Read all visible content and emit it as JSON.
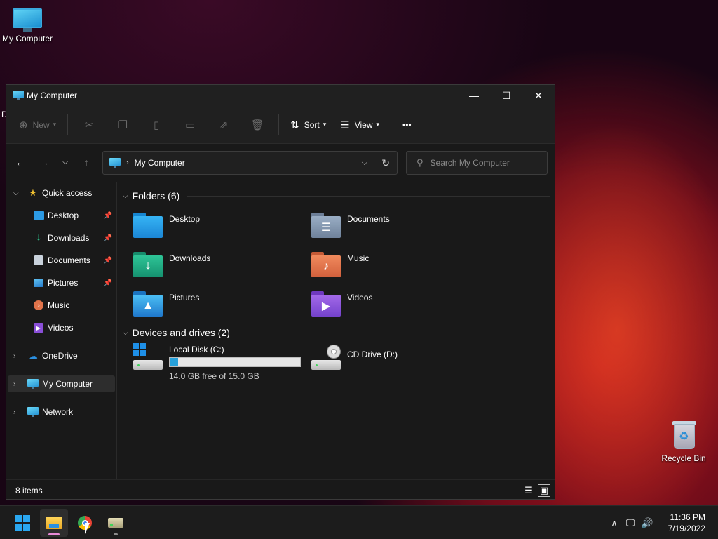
{
  "desktop": {
    "icons": [
      {
        "label": "My Computer"
      },
      {
        "label": "Recycle Bin"
      }
    ],
    "clipped_label": "D"
  },
  "window": {
    "title": "My Computer",
    "controls": {
      "minimize": "—",
      "maximize": "☐",
      "close": "✕"
    }
  },
  "toolbar": {
    "new_label": "New",
    "sort_label": "Sort",
    "view_label": "View",
    "more_label": "•••"
  },
  "address": {
    "location": "My Computer",
    "search_placeholder": "Search My Computer"
  },
  "sidebar": {
    "items": [
      {
        "label": "Quick access"
      },
      {
        "label": "Desktop"
      },
      {
        "label": "Downloads"
      },
      {
        "label": "Documents"
      },
      {
        "label": "Pictures"
      },
      {
        "label": "Music"
      },
      {
        "label": "Videos"
      },
      {
        "label": "OneDrive"
      },
      {
        "label": "My Computer"
      },
      {
        "label": "Network"
      }
    ]
  },
  "content": {
    "folders_header": "Folders (6)",
    "folders": [
      {
        "label": "Desktop",
        "color": "#1e9ae6"
      },
      {
        "label": "Documents",
        "color": "#7f93ad"
      },
      {
        "label": "Downloads",
        "color": "#1fa886"
      },
      {
        "label": "Music",
        "color": "#e0734a"
      },
      {
        "label": "Pictures",
        "color": "#2b8ed8"
      },
      {
        "label": "Videos",
        "color": "#8a4fd8"
      }
    ],
    "drives_header": "Devices and drives (2)",
    "drives": [
      {
        "label": "Local Disk (C:)",
        "free_text": "14.0 GB free of 15.0 GB",
        "used_fraction": 0.067
      },
      {
        "label": "CD Drive (D:)"
      }
    ]
  },
  "status": {
    "item_count": "8 items"
  },
  "taskbar": {
    "time": "11:36 PM",
    "date": "7/19/2022"
  },
  "colors": {
    "accent": "#26a0da",
    "window_bg": "#191919",
    "toolbar_bg": "#202020"
  }
}
